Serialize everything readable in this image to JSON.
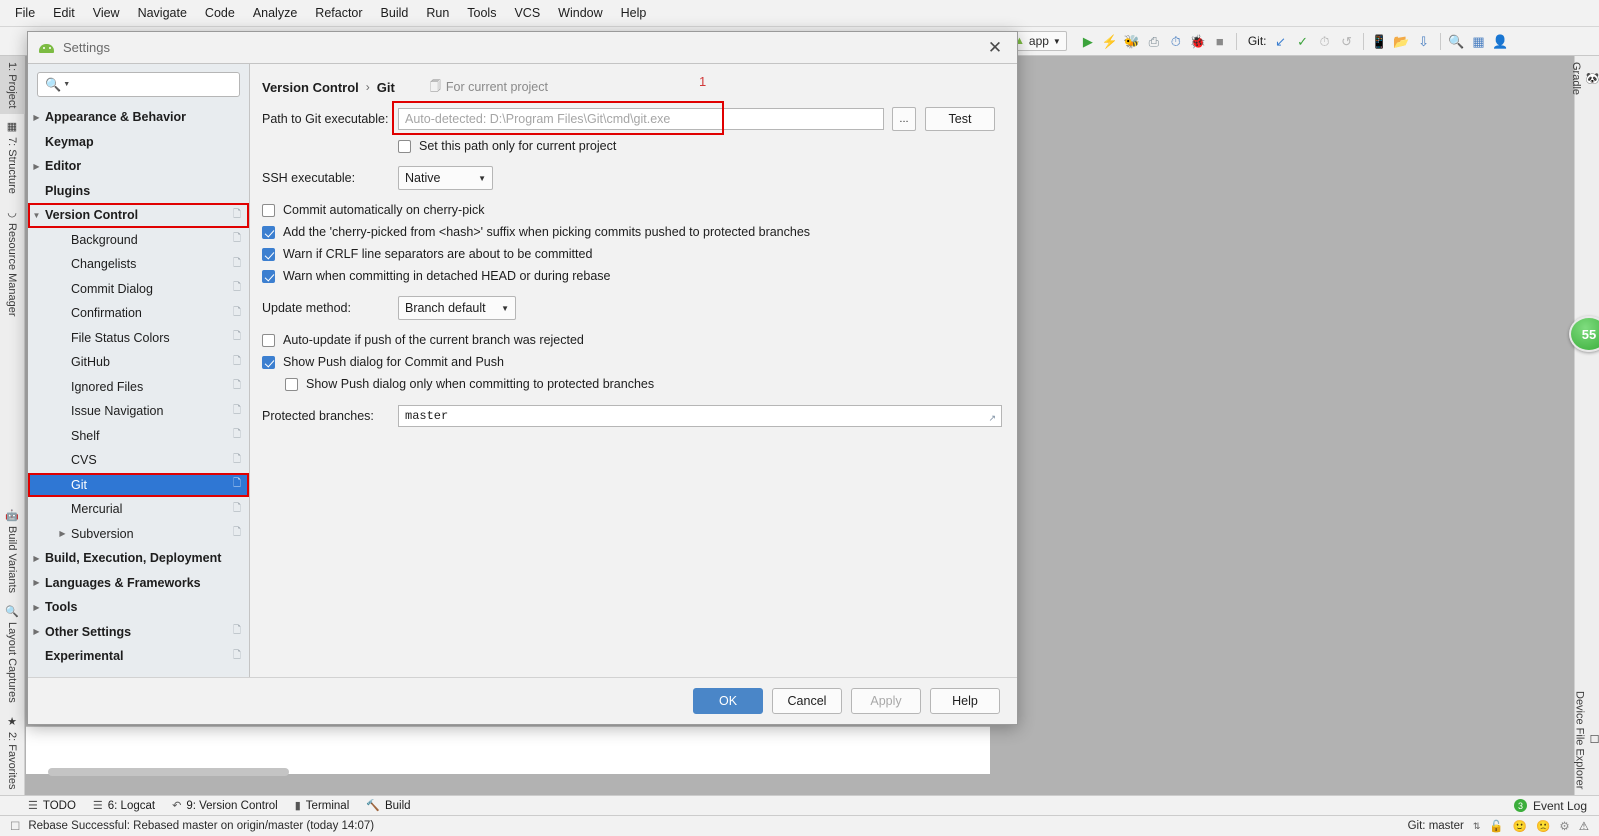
{
  "ide": {
    "menu": [
      "File",
      "Edit",
      "View",
      "Navigate",
      "Code",
      "Analyze",
      "Refactor",
      "Build",
      "Run",
      "Tools",
      "VCS",
      "Window",
      "Help"
    ],
    "toolbar": {
      "run_config": "app",
      "git_label": "Git:",
      "icons": [
        "run-icon",
        "apply-changes-icon",
        "debug-icon",
        "attach-debugger-icon",
        "profiler-icon",
        "run-with-coverage-icon",
        "stop-icon",
        "update-project-icon",
        "commit-icon",
        "history-icon",
        "rollback-icon",
        "avd-manager-icon",
        "sdk-manager-icon",
        "sync-gradle-icon",
        "search-everywhere-icon",
        "project-structure-icon",
        "user-icon"
      ]
    },
    "left_strip": [
      "1: Project",
      "7: Structure",
      "Resource Manager",
      "Build Variants",
      "Layout Captures",
      "2: Favorites"
    ],
    "right_strip": [
      "Gradle",
      "Device File Explorer"
    ],
    "badge": "55",
    "toolwindow_bar": {
      "items": [
        {
          "label": "TODO",
          "icon": "todo-icon"
        },
        {
          "label": "6: Logcat",
          "icon": "logcat-icon"
        },
        {
          "label": "9: Version Control",
          "icon": "version-control-icon"
        },
        {
          "label": "Terminal",
          "icon": "terminal-icon"
        },
        {
          "label": "Build",
          "icon": "build-icon"
        }
      ],
      "event_log": "Event Log",
      "event_count": "3"
    },
    "statusbar": {
      "message": "Rebase Successful: Rebased master on origin/master (today 14:07)",
      "git_branch": "Git: master",
      "icons": [
        "lock-open-icon",
        "happy-face-icon",
        "sad-face-icon",
        "memory-icon",
        "notifications-icon"
      ]
    }
  },
  "dialog": {
    "title": "Settings",
    "close_label": "✕",
    "search": {
      "value": "",
      "placeholder": ""
    },
    "tree": [
      {
        "label": "Appearance & Behavior",
        "level": 0,
        "arrow": "collapsed",
        "bold": true,
        "copy": false,
        "selected": false,
        "highlight": false
      },
      {
        "label": "Keymap",
        "level": 0,
        "arrow": "none",
        "bold": true,
        "copy": false,
        "selected": false,
        "highlight": false
      },
      {
        "label": "Editor",
        "level": 0,
        "arrow": "collapsed",
        "bold": true,
        "copy": false,
        "selected": false,
        "highlight": false
      },
      {
        "label": "Plugins",
        "level": 0,
        "arrow": "none",
        "bold": true,
        "copy": false,
        "selected": false,
        "highlight": false
      },
      {
        "label": "Version Control",
        "level": 0,
        "arrow": "expanded",
        "bold": true,
        "copy": true,
        "selected": false,
        "highlight": true
      },
      {
        "label": "Background",
        "level": 1,
        "arrow": "none",
        "bold": false,
        "copy": true,
        "selected": false,
        "highlight": false
      },
      {
        "label": "Changelists",
        "level": 1,
        "arrow": "none",
        "bold": false,
        "copy": true,
        "selected": false,
        "highlight": false
      },
      {
        "label": "Commit Dialog",
        "level": 1,
        "arrow": "none",
        "bold": false,
        "copy": true,
        "selected": false,
        "highlight": false
      },
      {
        "label": "Confirmation",
        "level": 1,
        "arrow": "none",
        "bold": false,
        "copy": true,
        "selected": false,
        "highlight": false
      },
      {
        "label": "File Status Colors",
        "level": 1,
        "arrow": "none",
        "bold": false,
        "copy": true,
        "selected": false,
        "highlight": false
      },
      {
        "label": "GitHub",
        "level": 1,
        "arrow": "none",
        "bold": false,
        "copy": true,
        "selected": false,
        "highlight": false
      },
      {
        "label": "Ignored Files",
        "level": 1,
        "arrow": "none",
        "bold": false,
        "copy": true,
        "selected": false,
        "highlight": false
      },
      {
        "label": "Issue Navigation",
        "level": 1,
        "arrow": "none",
        "bold": false,
        "copy": true,
        "selected": false,
        "highlight": false
      },
      {
        "label": "Shelf",
        "level": 1,
        "arrow": "none",
        "bold": false,
        "copy": true,
        "selected": false,
        "highlight": false
      },
      {
        "label": "CVS",
        "level": 1,
        "arrow": "none",
        "bold": false,
        "copy": true,
        "selected": false,
        "highlight": false
      },
      {
        "label": "Git",
        "level": 1,
        "arrow": "none",
        "bold": false,
        "copy": true,
        "selected": true,
        "highlight": true
      },
      {
        "label": "Mercurial",
        "level": 1,
        "arrow": "none",
        "bold": false,
        "copy": true,
        "selected": false,
        "highlight": false
      },
      {
        "label": "Subversion",
        "level": 1,
        "arrow": "collapsed",
        "bold": false,
        "copy": true,
        "selected": false,
        "highlight": false
      },
      {
        "label": "Build, Execution, Deployment",
        "level": 0,
        "arrow": "collapsed",
        "bold": true,
        "copy": false,
        "selected": false,
        "highlight": false
      },
      {
        "label": "Languages & Frameworks",
        "level": 0,
        "arrow": "collapsed",
        "bold": true,
        "copy": false,
        "selected": false,
        "highlight": false
      },
      {
        "label": "Tools",
        "level": 0,
        "arrow": "collapsed",
        "bold": true,
        "copy": false,
        "selected": false,
        "highlight": false
      },
      {
        "label": "Other Settings",
        "level": 0,
        "arrow": "collapsed",
        "bold": true,
        "copy": true,
        "selected": false,
        "highlight": false
      },
      {
        "label": "Experimental",
        "level": 0,
        "arrow": "none",
        "bold": true,
        "copy": true,
        "selected": false,
        "highlight": false
      }
    ],
    "breadcrumb": {
      "parent": "Version Control",
      "separator": "›",
      "current": "Git",
      "for_current_project": "For current project",
      "annotation": "1"
    },
    "git": {
      "path_label": "Path to Git executable:",
      "path_value": "",
      "path_placeholder": "Auto-detected: D:\\Program Files\\Git\\cmd\\git.exe",
      "browse_label": "...",
      "test_label": "Test",
      "set_path_only_label": "Set this path only for current project",
      "set_path_only_checked": false,
      "ssh_label": "SSH executable:",
      "ssh_value": "Native",
      "checkboxes": [
        {
          "label": "Commit automatically on cherry-pick",
          "checked": false,
          "indent": false
        },
        {
          "label": "Add the 'cherry-picked from <hash>' suffix when picking commits pushed to protected branches",
          "checked": true,
          "indent": false
        },
        {
          "label": "Warn if CRLF line separators are about to be committed",
          "checked": true,
          "indent": false
        },
        {
          "label": "Warn when committing in detached HEAD or during rebase",
          "checked": true,
          "indent": false
        }
      ],
      "update_label": "Update method:",
      "update_value": "Branch default",
      "checkboxes2": [
        {
          "label": "Auto-update if push of the current branch was rejected",
          "checked": false,
          "indent": false
        },
        {
          "label": "Show Push dialog for Commit and Push",
          "checked": true,
          "indent": false
        },
        {
          "label": "Show Push dialog only when committing to protected branches",
          "checked": false,
          "indent": true
        }
      ],
      "protected_label": "Protected branches:",
      "protected_value": "master"
    },
    "buttons": {
      "ok": "OK",
      "cancel": "Cancel",
      "apply": "Apply",
      "help": "Help"
    }
  },
  "colors": {
    "accent": "#2f77d4",
    "primary_button": "#4a86c8",
    "highlight_red": "#e00000",
    "checkbox_blue": "#3c7fd0",
    "badge_green": "#36ab36",
    "annotation_red": "#d13a3a"
  }
}
